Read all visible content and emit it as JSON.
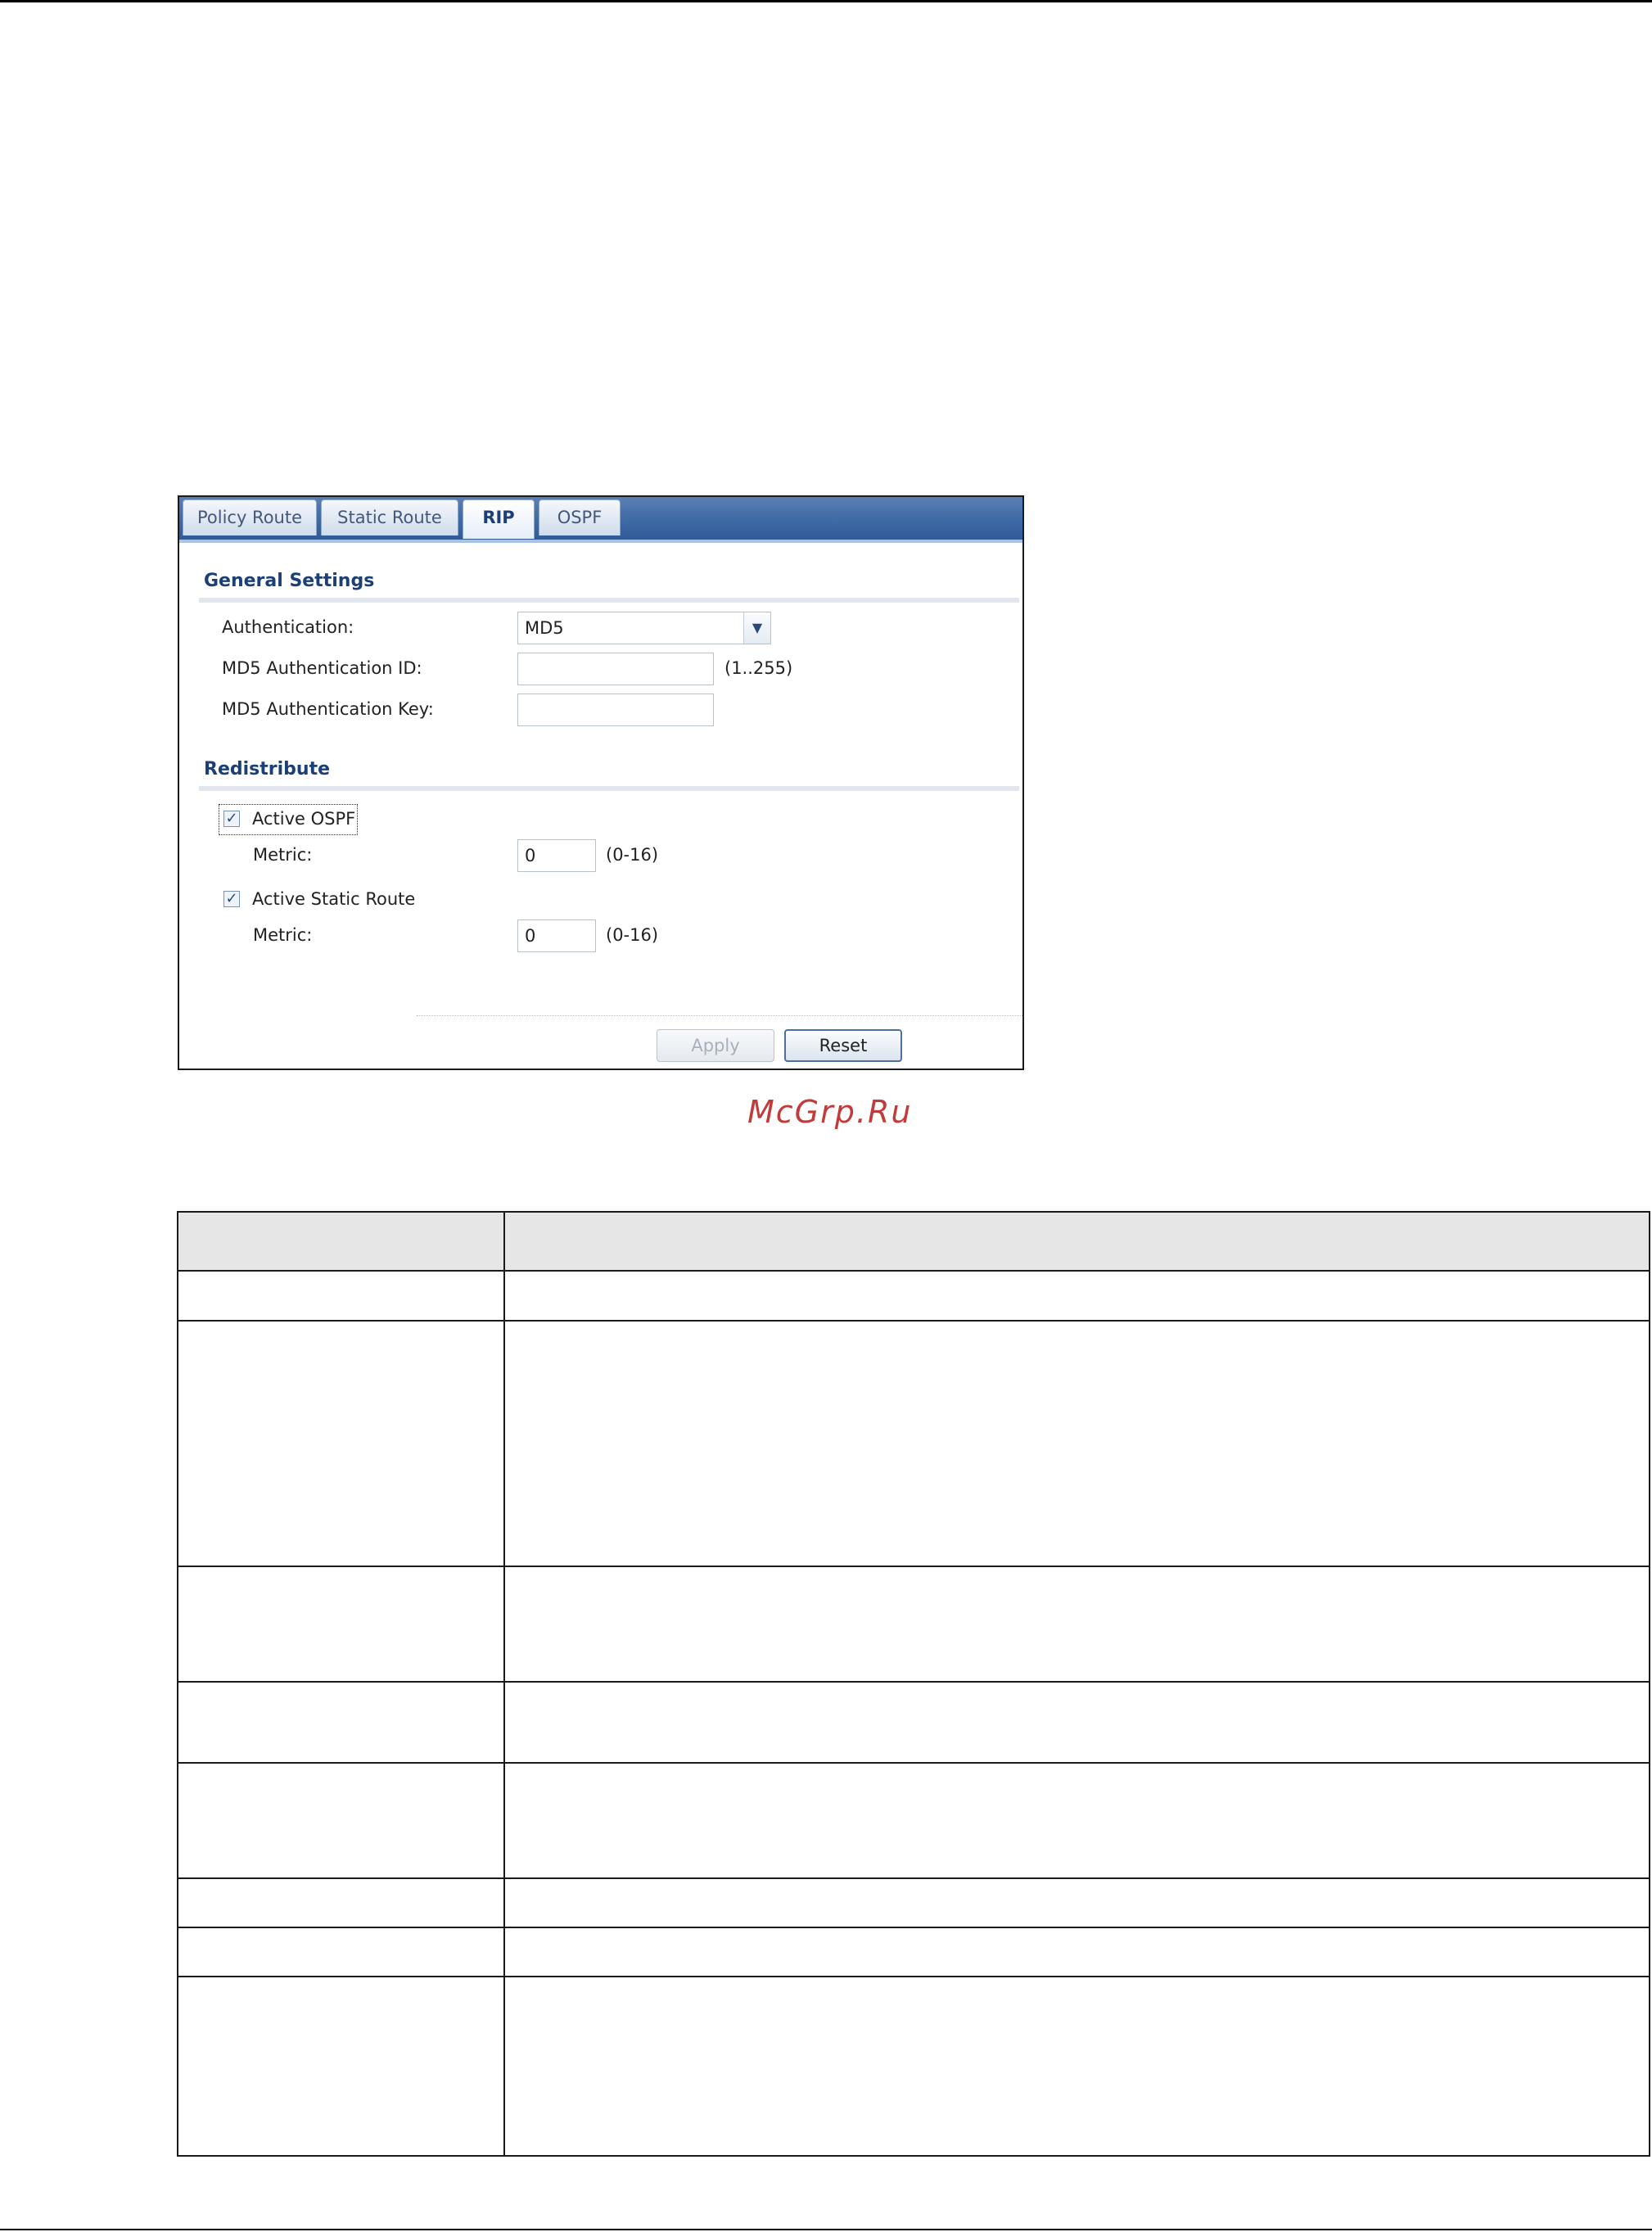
{
  "tabs": [
    {
      "label": "Policy Route",
      "active": false
    },
    {
      "label": "Static Route",
      "active": false
    },
    {
      "label": "RIP",
      "active": true
    },
    {
      "label": "OSPF",
      "active": false
    }
  ],
  "general_settings": {
    "title": "General Settings",
    "authentication": {
      "label": "Authentication:",
      "value": "MD5"
    },
    "md5_id": {
      "label": "MD5 Authentication ID:",
      "value": "",
      "hint": "(1..255)"
    },
    "md5_key": {
      "label": "MD5 Authentication Key:",
      "value": ""
    }
  },
  "redistribute": {
    "title": "Redistribute",
    "ospf": {
      "label": "Active OSPF",
      "checked": true,
      "metric_label": "Metric:",
      "metric_value": "0",
      "hint": "(0-16)"
    },
    "static": {
      "label": "Active Static Route",
      "checked": true,
      "metric_label": "Metric:",
      "metric_value": "0",
      "hint": "(0-16)"
    }
  },
  "buttons": {
    "apply": "Apply",
    "reset": "Reset"
  },
  "watermark": "McGrp.Ru",
  "colors": {
    "tab_bar": "#3e6aa5",
    "section_title": "#1d3f78",
    "watermark": "#c33a3a"
  }
}
